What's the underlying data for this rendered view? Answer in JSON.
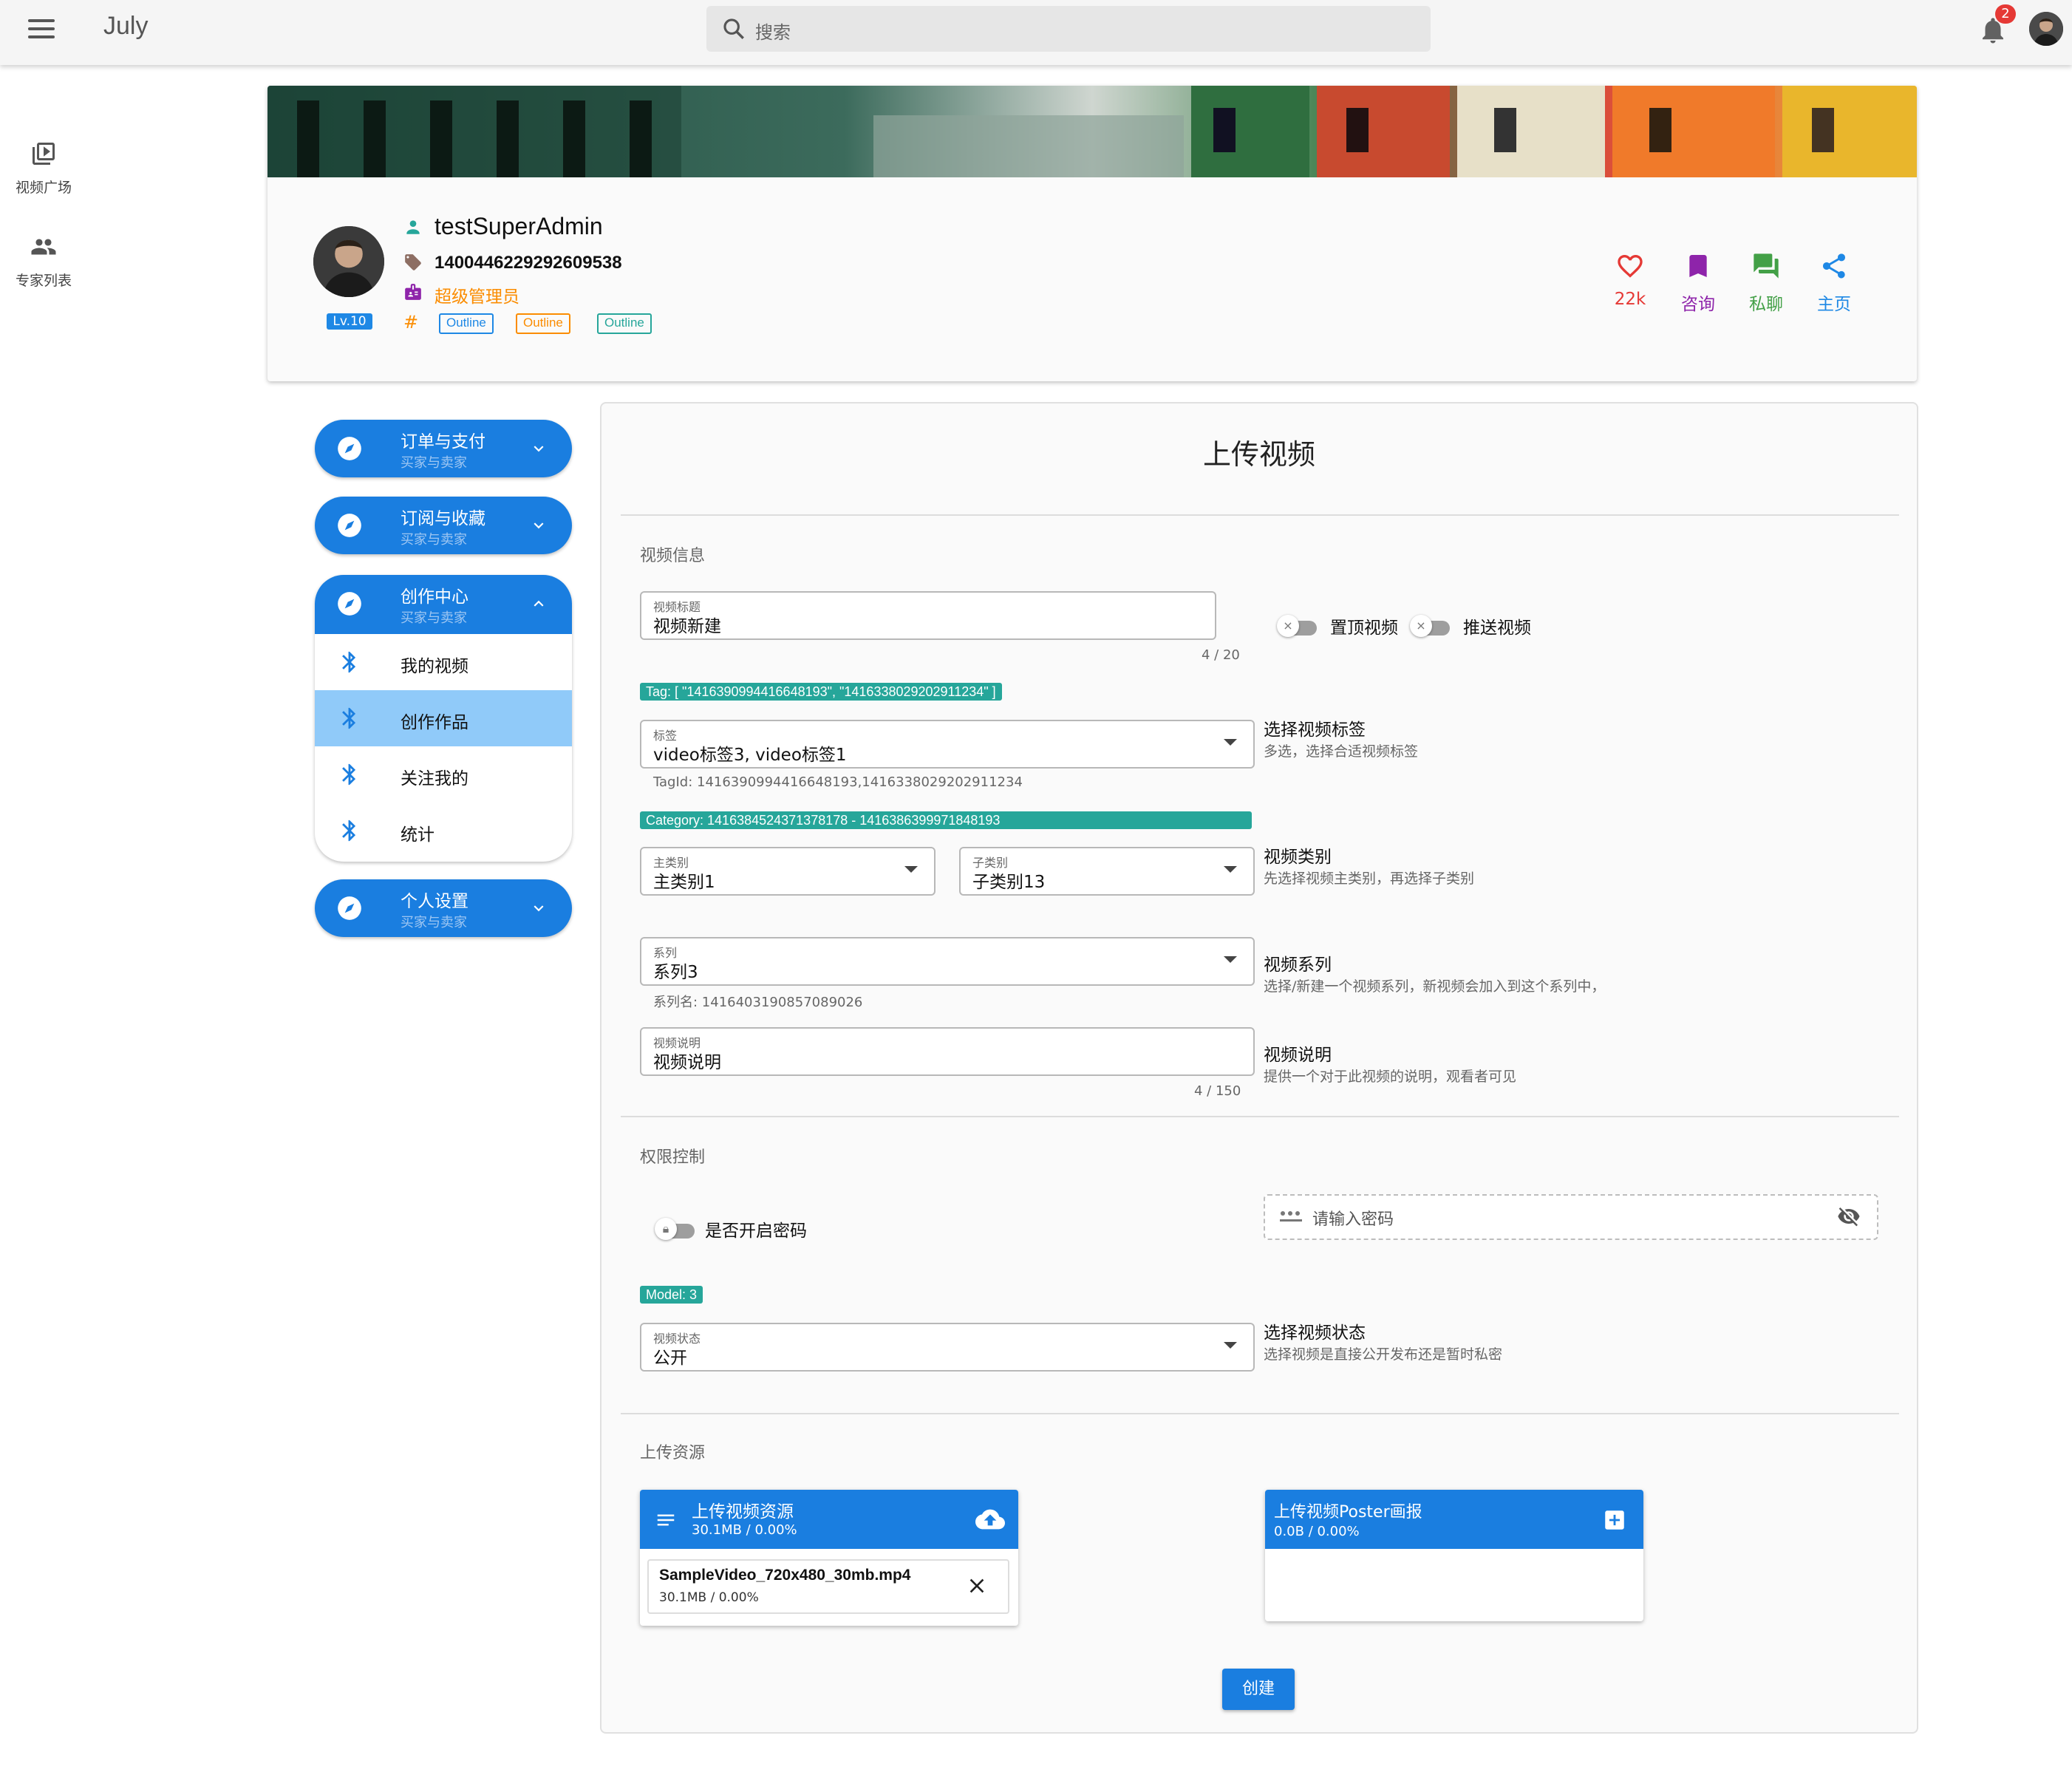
{
  "app": {
    "title": "July"
  },
  "search": {
    "placeholder": "搜索"
  },
  "notifications": {
    "count": "2"
  },
  "rail": [
    {
      "label": "视频广场",
      "icon": "video-library-icon"
    },
    {
      "label": "专家列表",
      "icon": "people-icon"
    }
  ],
  "profile": {
    "username": "testSuperAdmin",
    "user_id": "1400446229292609538",
    "role": "超级管理员",
    "level": "Lv.10",
    "chips": [
      "Outline",
      "Outline",
      "Outline"
    ],
    "chip_colors": [
      "#1e88e5",
      "#fb8c00",
      "#26a69a"
    ],
    "stats": [
      {
        "label": "22k",
        "icon": "heart-icon",
        "color": "#e53935"
      },
      {
        "label": "咨询",
        "icon": "bookmark-icon",
        "color": "#8e24aa"
      },
      {
        "label": "私聊",
        "icon": "chat-icon",
        "color": "#43a047"
      },
      {
        "label": "主页",
        "icon": "share-icon",
        "color": "#1e88e5"
      }
    ]
  },
  "menu": {
    "groups": [
      {
        "title": "订单与支付",
        "subtitle": "买家与卖家"
      },
      {
        "title": "订阅与收藏",
        "subtitle": "买家与卖家"
      },
      {
        "title": "创作中心",
        "subtitle": "买家与卖家"
      },
      {
        "title": "个人设置",
        "subtitle": "买家与卖家"
      }
    ],
    "creation_items": [
      "我的视频",
      "创作作品",
      "关注我的",
      "统计"
    ],
    "active_item": "创作作品"
  },
  "form": {
    "title": "上传视频",
    "section_video": "视频信息",
    "video_title": {
      "label": "视频标题",
      "value": "视频新建",
      "counter": "4 / 20"
    },
    "pin_label": "置顶视频",
    "push_label": "推送视频",
    "tag_chip": "Tag: [ \"1416390994416648193\", \"1416338029202911234\" ]",
    "tags": {
      "label": "标签",
      "value": "video标签3, video标签1",
      "hint": "TagId: 1416390994416648193,1416338029202911234"
    },
    "tags_side": {
      "title": "选择视频标签",
      "sub": "多选，选择合适视频标签"
    },
    "category_chip": "Category: 1416384524371378178 - 1416386399971848193",
    "main_category": {
      "label": "主类别",
      "value": "主类别1"
    },
    "sub_category": {
      "label": "子类别",
      "value": "子类别13"
    },
    "category_side": {
      "title": "视频类别",
      "sub": "先选择视频主类别，再选择子类别"
    },
    "series": {
      "label": "系列",
      "value": "系列3",
      "hint": "系列名: 1416403190857089026"
    },
    "series_side": {
      "title": "视频系列",
      "sub": "选择/新建一个视频系列，新视频会加入到这个系列中，"
    },
    "description": {
      "label": "视频说明",
      "value": "视频说明",
      "counter": "4 / 150"
    },
    "description_side": {
      "title": "视频说明",
      "sub": "提供一个对于此视频的说明，观看者可见"
    },
    "section_permission": "权限控制",
    "password_toggle": "是否开启密码",
    "password_placeholder": "请输入密码",
    "model_chip": "Model: 3",
    "status": {
      "label": "视频状态",
      "value": "公开"
    },
    "status_side": {
      "title": "选择视频状态",
      "sub": "选择视频是直接公开发布还是暂时私密"
    },
    "section_upload": "上传资源",
    "video_upload": {
      "title": "上传视频资源",
      "progress": "30.1MB / 0.00%",
      "file_name": "SampleVideo_720x480_30mb.mp4",
      "file_progress": "30.1MB / 0.00%"
    },
    "poster_upload": {
      "title": "上传视频Poster画报",
      "progress": "0.0B / 0.00%"
    },
    "create_button": "创建"
  },
  "colors": {
    "primary": "#1a7ee0",
    "active_item": "#90caf9",
    "chip_green": "#26a69a",
    "role_orange": "#fb8c00"
  }
}
